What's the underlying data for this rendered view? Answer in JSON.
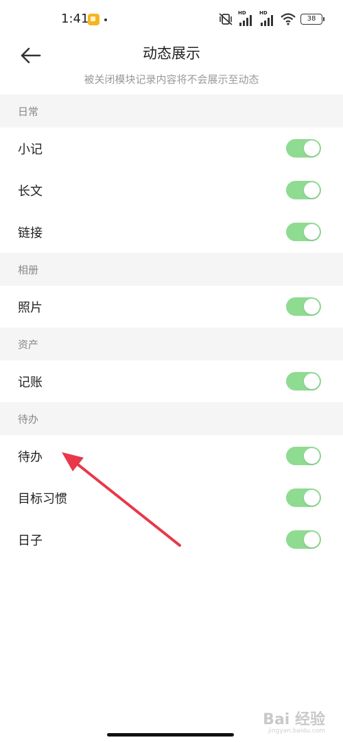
{
  "status_bar": {
    "time": "1:41",
    "battery": "38",
    "icons": [
      "notification-app-icon",
      "mute-vibrate-icon",
      "signal-hd-icon",
      "signal-hd-icon",
      "wifi-icon",
      "battery-icon"
    ],
    "hd_label": "HD"
  },
  "header": {
    "title": "动态展示",
    "subtitle": "被关闭模块记录内容将不会展示至动态",
    "back_icon": "back-arrow-icon"
  },
  "sections": [
    {
      "title": "日常",
      "items": [
        {
          "label": "小记",
          "enabled": true
        },
        {
          "label": "长文",
          "enabled": true
        },
        {
          "label": "链接",
          "enabled": true
        }
      ]
    },
    {
      "title": "相册",
      "items": [
        {
          "label": "照片",
          "enabled": true
        }
      ]
    },
    {
      "title": "资产",
      "items": [
        {
          "label": "记账",
          "enabled": true
        }
      ]
    },
    {
      "title": "待办",
      "items": [
        {
          "label": "待办",
          "enabled": true
        },
        {
          "label": "目标习惯",
          "enabled": true
        },
        {
          "label": "日子",
          "enabled": true
        }
      ]
    }
  ],
  "colors": {
    "toggle_on": "#8fdb91",
    "section_bg": "#f5f5f5",
    "annotation_arrow": "#e8384a"
  },
  "watermark": {
    "text": "Bai 经验",
    "sub": "jingyan.baidu.com"
  }
}
